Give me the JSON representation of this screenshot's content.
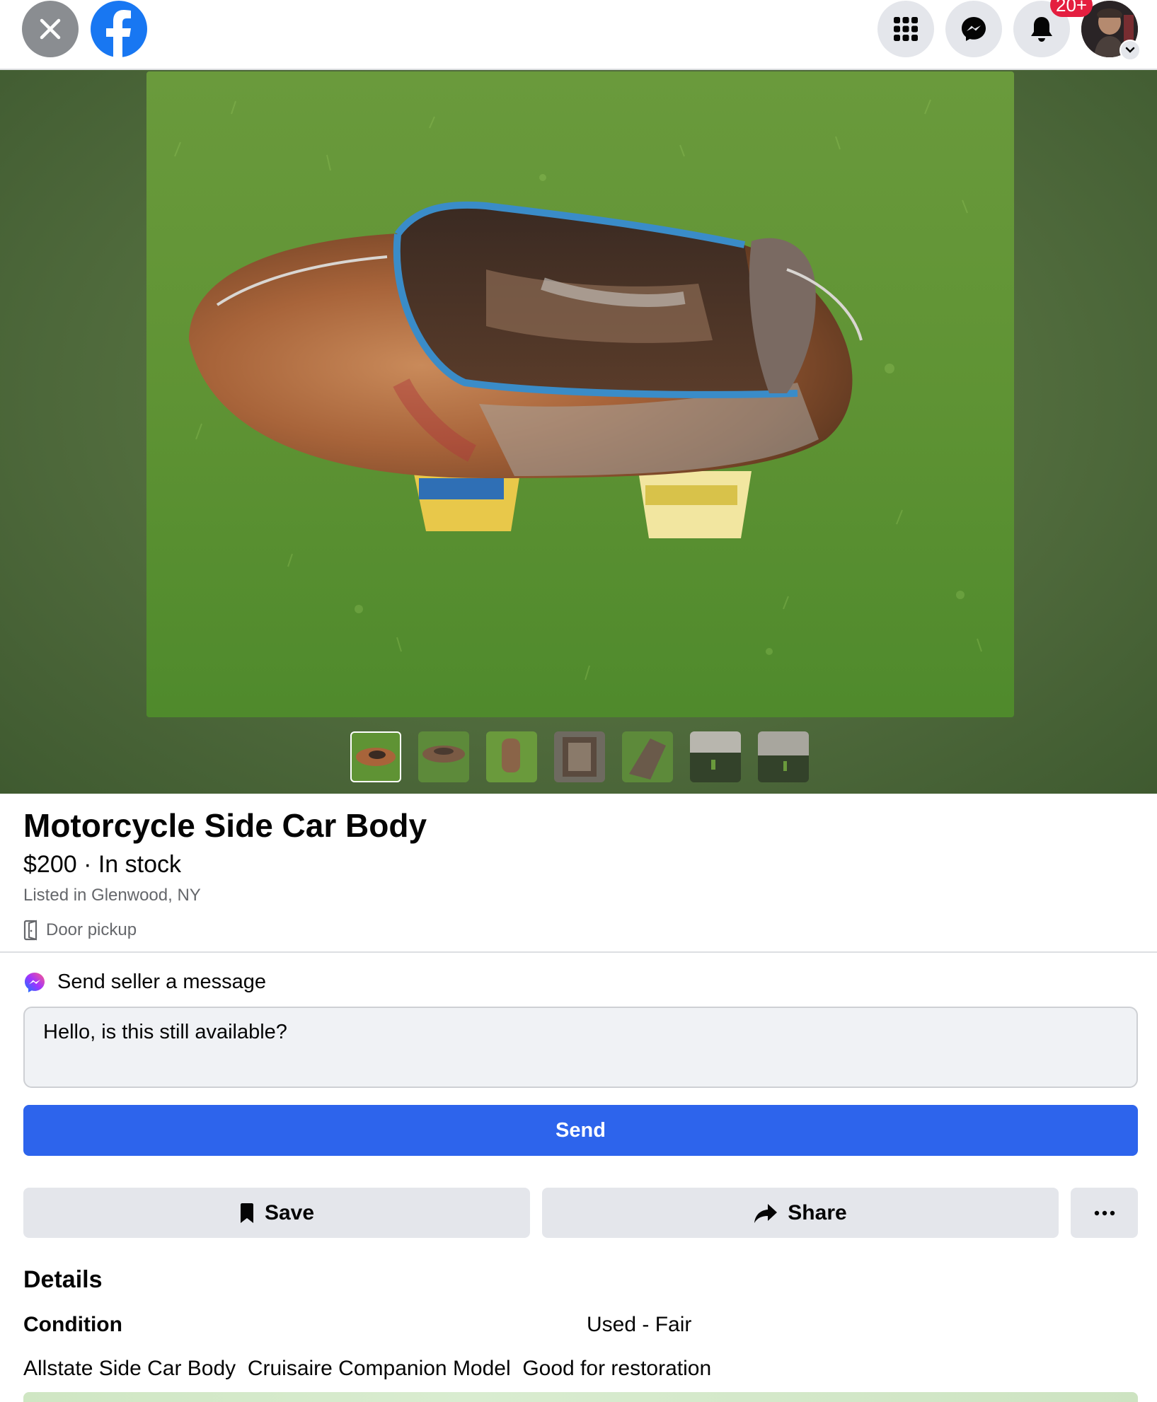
{
  "header": {
    "close_icon": "close-icon",
    "logo": "facebook-logo",
    "apps_icon": "grid-menu-icon",
    "messenger_icon": "messenger-icon",
    "notifications_icon": "bell-icon",
    "notification_badge": "20+",
    "accent_color": "#1877f2",
    "badge_color": "#e41e3f"
  },
  "listing": {
    "title": "Motorcycle Side Car Body",
    "price_line": "$200 · In stock",
    "location": "Listed in Glenwood, NY",
    "pickup": "Door pickup",
    "photo_count": 7,
    "active_photo_index": 0
  },
  "message": {
    "header": "Send seller a message",
    "text": "Hello, is this still available?",
    "send_label": "Send",
    "button_color": "#2d64ec"
  },
  "actions": {
    "save_label": "Save",
    "share_label": "Share",
    "more_icon": "more-horizontal-icon"
  },
  "details": {
    "heading": "Details",
    "condition_label": "Condition",
    "condition_value": "Used - Fair",
    "description": "Allstate Side Car Body  Cruisaire Companion Model  Good for restoration"
  }
}
